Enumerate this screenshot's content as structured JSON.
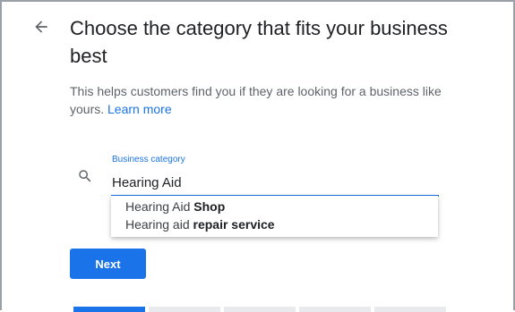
{
  "header": {
    "title": "Choose the category that fits your business best"
  },
  "description": {
    "text": "This helps customers find you if they are looking for a business like yours.",
    "link_text": "Learn more"
  },
  "category_field": {
    "label": "Business category",
    "value": "Hearing Aid"
  },
  "suggestions": [
    {
      "match": "Hearing Aid",
      "rest": "Shop"
    },
    {
      "match": "Hearing aid",
      "rest": "repair service"
    }
  ],
  "actions": {
    "next_label": "Next"
  },
  "colors": {
    "accent": "#1a73e8",
    "text": "#202124",
    "secondary_text": "#5f6368"
  },
  "progress": {
    "total_steps": 5,
    "current_step": 1
  }
}
